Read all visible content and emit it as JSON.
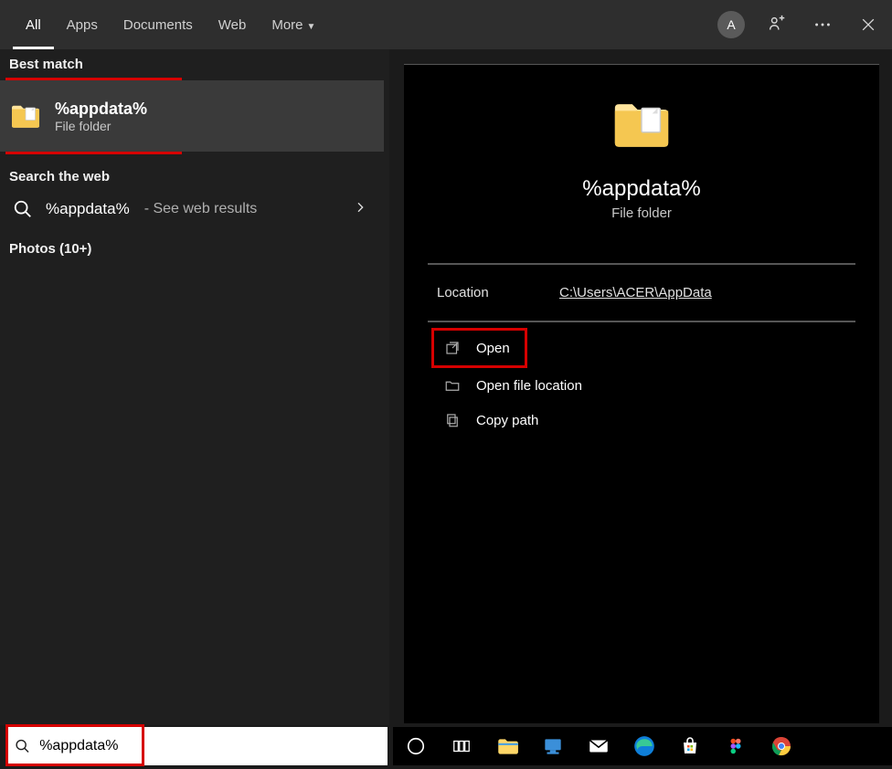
{
  "tabs": {
    "items": [
      "All",
      "Apps",
      "Documents",
      "Web",
      "More"
    ],
    "active_index": 0
  },
  "avatar_letter": "A",
  "left": {
    "best_match_label": "Best match",
    "best_match": {
      "title": "%appdata%",
      "subtitle": "File folder"
    },
    "search_web_label": "Search the web",
    "web_result": {
      "query": "%appdata%",
      "suffix": " - See web results"
    },
    "photos_label": "Photos (10+)"
  },
  "preview": {
    "title": "%appdata%",
    "subtitle": "File folder",
    "location_label": "Location",
    "location_value": "C:\\Users\\ACER\\AppData",
    "actions": {
      "open": "Open",
      "open_location": "Open file location",
      "copy_path": "Copy path"
    }
  },
  "search_input_value": "%appdata%"
}
